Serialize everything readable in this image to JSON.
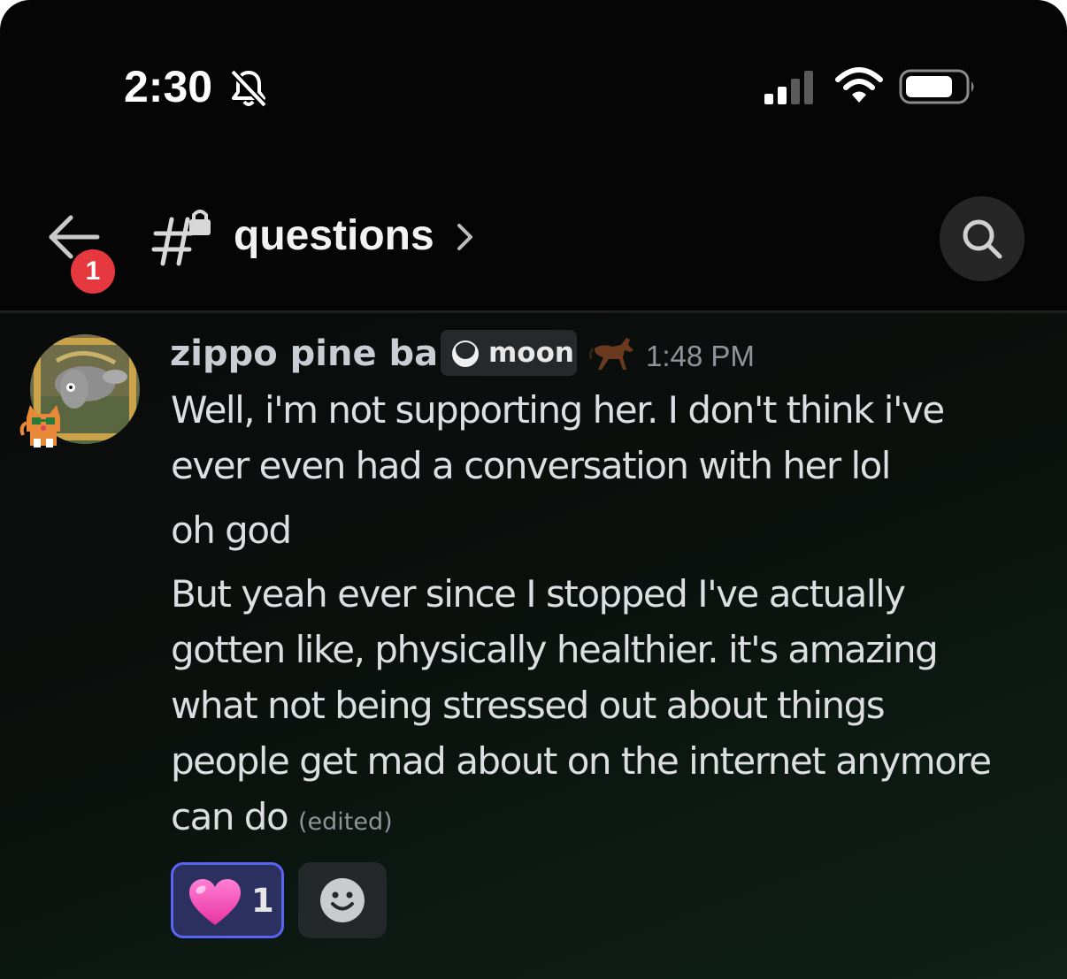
{
  "status_bar": {
    "time": "2:30"
  },
  "header": {
    "badge_count": "1",
    "channel_name": "questions"
  },
  "message": {
    "author": "zippo pine bar",
    "tag": "moon",
    "timestamp": "1:48 PM",
    "lines": [
      "Well, i'm not supporting her. I don't think i've",
      "ever even had a conversation with her lol",
      "oh god",
      "But yeah ever since I stopped I've actually",
      "gotten like, physically healthier. it's amazing",
      "what not being stressed out about things",
      "people get mad about on the internet anymore",
      "can do"
    ],
    "edited_label": "(edited)",
    "reaction": {
      "emoji": "pink-heart",
      "count": "1"
    }
  },
  "colors": {
    "accent": "#5865f2",
    "badge": "#e5393f",
    "reaction_bg": "#2c3060"
  }
}
